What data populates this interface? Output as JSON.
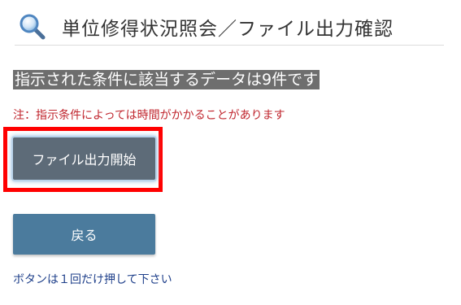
{
  "header": {
    "icon": "search-icon",
    "title": "単位修得状況照会／ファイル出力確認"
  },
  "main": {
    "result_message": "指示された条件に該当するデータは9件です",
    "note": "注：指示条件によっては時間がかかることがあります",
    "output_button_label": "ファイル出力開始",
    "back_button_label": "戻る",
    "footnote": "ボタンは１回だけ押して下さい"
  },
  "colors": {
    "highlight": "#ff0000",
    "note_text": "#c0262e",
    "footnote_text": "#1e3f8a",
    "output_button": "#5d6b78",
    "back_button": "#4b7b9d"
  }
}
